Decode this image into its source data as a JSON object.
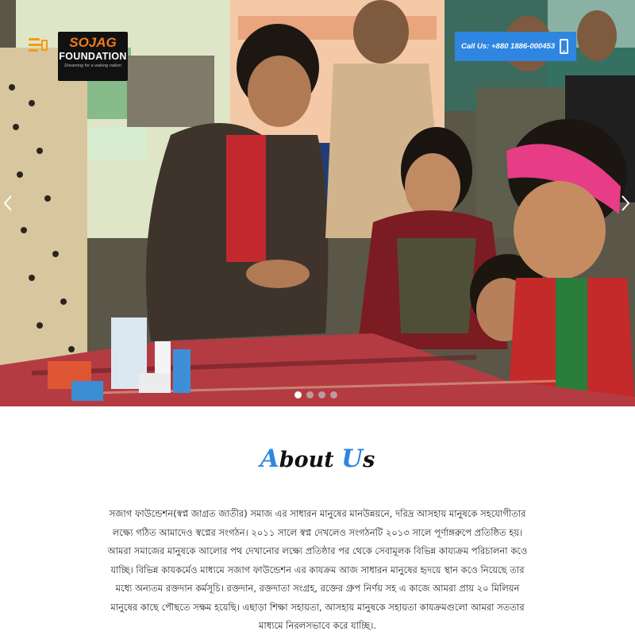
{
  "header": {
    "logo": {
      "brand": "SOJAG",
      "sub": "FOUNDATION",
      "tagline": "Dreaming for a waking nation"
    },
    "call": {
      "label": "Call Us: +880 1886-000453"
    },
    "icons": {
      "menu": "hamburger-icon",
      "phone": "mobile-phone-icon"
    }
  },
  "slider": {
    "prev_icon": "chevron-left-icon",
    "next_icon": "chevron-right-icon",
    "indicator_count": 4,
    "active_index": 0
  },
  "about": {
    "title_cap1": "A",
    "title_rest1": "bout ",
    "title_cap2": "U",
    "title_rest2": "s",
    "body": "সজাগ ফাউন্ডেশন(স্বপ্ন জাগ্রত জাতীর) সমাজ এর সাধারন মানুষের মানউন্নয়নে, দরিদ্র আসহায় মানুষকে সহযোগীতার লক্ষ্যে গঠিত আমাদেও স্বপ্নের সংগঠন। ২০১১ সালে স্বপ্ন দেখলেও সংগঠনটি ২০১৩ সালে পূর্ণাঙ্গরুপে প্রতিষ্ঠিত হয়। আমরা সমাজের মানুষকে আলোর পথ দেখানোর লক্ষ্যে প্রতিষ্ঠার পর থেকে সেবামূলক বিভিন্ন কায্যক্রম পরিচালনা কওে যাচ্ছি। বিভিন্ন কাযকর্মেও মাধ্যমে সজাগ ফাউন্ডেশন এর কাযক্রম আজ সাধারন মানুষের হৃদয়ে স্থান কওে নিয়েছে তার মধ্যে অন্যতম রক্তদান কর্মসূচি। রক্তদান, রক্তদাতা সংগ্রহ, রক্তের গ্রুপ নির্ণয় সহ এ কাজে আমরা প্রায় ২০ মিলিয়ন মানুষের কাছে পৌছতে সক্ষম হয়েছি। এছাড়া শিক্ষা সহায়তা, আসহায় মানুষকে সহায়তা কাযক্রমগুলো আমরা সততার মাধ্যমে নিরলসভাবে করে যাচ্ছি।."
  },
  "colors": {
    "accent": "#2e86e0",
    "logo_orange": "#f07a1c",
    "menu_orange": "#f39c12"
  }
}
